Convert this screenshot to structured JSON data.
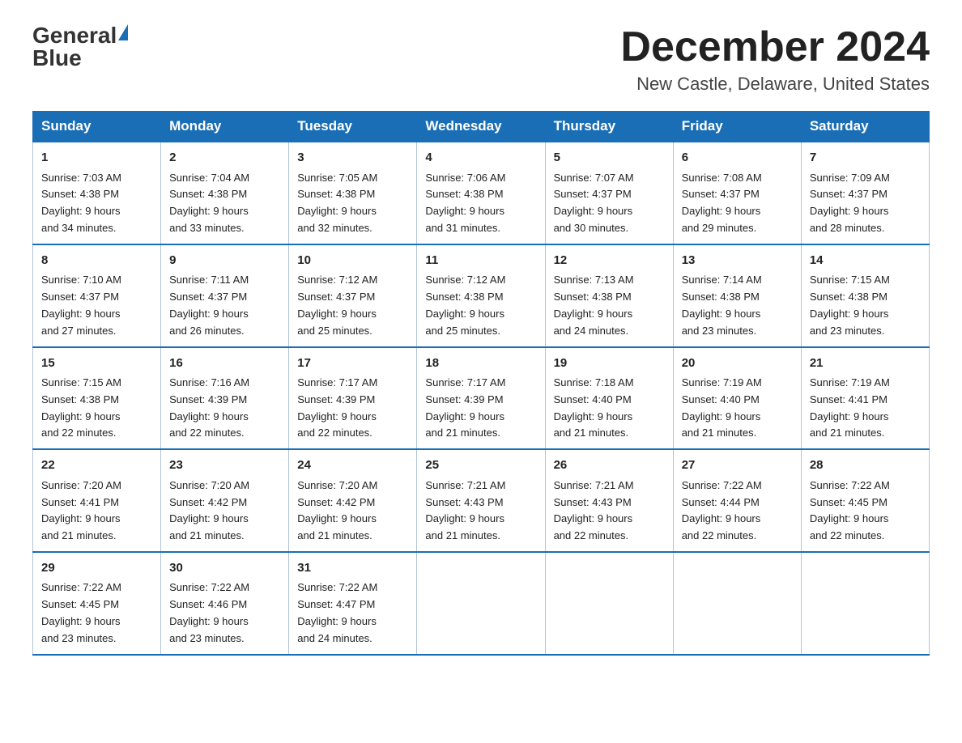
{
  "header": {
    "logo_text_general": "General",
    "logo_text_blue": "Blue",
    "month_title": "December 2024",
    "location": "New Castle, Delaware, United States"
  },
  "calendar": {
    "days_of_week": [
      "Sunday",
      "Monday",
      "Tuesday",
      "Wednesday",
      "Thursday",
      "Friday",
      "Saturday"
    ],
    "weeks": [
      [
        {
          "day": "1",
          "sunrise": "7:03 AM",
          "sunset": "4:38 PM",
          "daylight": "9 hours and 34 minutes."
        },
        {
          "day": "2",
          "sunrise": "7:04 AM",
          "sunset": "4:38 PM",
          "daylight": "9 hours and 33 minutes."
        },
        {
          "day": "3",
          "sunrise": "7:05 AM",
          "sunset": "4:38 PM",
          "daylight": "9 hours and 32 minutes."
        },
        {
          "day": "4",
          "sunrise": "7:06 AM",
          "sunset": "4:38 PM",
          "daylight": "9 hours and 31 minutes."
        },
        {
          "day": "5",
          "sunrise": "7:07 AM",
          "sunset": "4:37 PM",
          "daylight": "9 hours and 30 minutes."
        },
        {
          "day": "6",
          "sunrise": "7:08 AM",
          "sunset": "4:37 PM",
          "daylight": "9 hours and 29 minutes."
        },
        {
          "day": "7",
          "sunrise": "7:09 AM",
          "sunset": "4:37 PM",
          "daylight": "9 hours and 28 minutes."
        }
      ],
      [
        {
          "day": "8",
          "sunrise": "7:10 AM",
          "sunset": "4:37 PM",
          "daylight": "9 hours and 27 minutes."
        },
        {
          "day": "9",
          "sunrise": "7:11 AM",
          "sunset": "4:37 PM",
          "daylight": "9 hours and 26 minutes."
        },
        {
          "day": "10",
          "sunrise": "7:12 AM",
          "sunset": "4:37 PM",
          "daylight": "9 hours and 25 minutes."
        },
        {
          "day": "11",
          "sunrise": "7:12 AM",
          "sunset": "4:38 PM",
          "daylight": "9 hours and 25 minutes."
        },
        {
          "day": "12",
          "sunrise": "7:13 AM",
          "sunset": "4:38 PM",
          "daylight": "9 hours and 24 minutes."
        },
        {
          "day": "13",
          "sunrise": "7:14 AM",
          "sunset": "4:38 PM",
          "daylight": "9 hours and 23 minutes."
        },
        {
          "day": "14",
          "sunrise": "7:15 AM",
          "sunset": "4:38 PM",
          "daylight": "9 hours and 23 minutes."
        }
      ],
      [
        {
          "day": "15",
          "sunrise": "7:15 AM",
          "sunset": "4:38 PM",
          "daylight": "9 hours and 22 minutes."
        },
        {
          "day": "16",
          "sunrise": "7:16 AM",
          "sunset": "4:39 PM",
          "daylight": "9 hours and 22 minutes."
        },
        {
          "day": "17",
          "sunrise": "7:17 AM",
          "sunset": "4:39 PM",
          "daylight": "9 hours and 22 minutes."
        },
        {
          "day": "18",
          "sunrise": "7:17 AM",
          "sunset": "4:39 PM",
          "daylight": "9 hours and 21 minutes."
        },
        {
          "day": "19",
          "sunrise": "7:18 AM",
          "sunset": "4:40 PM",
          "daylight": "9 hours and 21 minutes."
        },
        {
          "day": "20",
          "sunrise": "7:19 AM",
          "sunset": "4:40 PM",
          "daylight": "9 hours and 21 minutes."
        },
        {
          "day": "21",
          "sunrise": "7:19 AM",
          "sunset": "4:41 PM",
          "daylight": "9 hours and 21 minutes."
        }
      ],
      [
        {
          "day": "22",
          "sunrise": "7:20 AM",
          "sunset": "4:41 PM",
          "daylight": "9 hours and 21 minutes."
        },
        {
          "day": "23",
          "sunrise": "7:20 AM",
          "sunset": "4:42 PM",
          "daylight": "9 hours and 21 minutes."
        },
        {
          "day": "24",
          "sunrise": "7:20 AM",
          "sunset": "4:42 PM",
          "daylight": "9 hours and 21 minutes."
        },
        {
          "day": "25",
          "sunrise": "7:21 AM",
          "sunset": "4:43 PM",
          "daylight": "9 hours and 21 minutes."
        },
        {
          "day": "26",
          "sunrise": "7:21 AM",
          "sunset": "4:43 PM",
          "daylight": "9 hours and 22 minutes."
        },
        {
          "day": "27",
          "sunrise": "7:22 AM",
          "sunset": "4:44 PM",
          "daylight": "9 hours and 22 minutes."
        },
        {
          "day": "28",
          "sunrise": "7:22 AM",
          "sunset": "4:45 PM",
          "daylight": "9 hours and 22 minutes."
        }
      ],
      [
        {
          "day": "29",
          "sunrise": "7:22 AM",
          "sunset": "4:45 PM",
          "daylight": "9 hours and 23 minutes."
        },
        {
          "day": "30",
          "sunrise": "7:22 AM",
          "sunset": "4:46 PM",
          "daylight": "9 hours and 23 minutes."
        },
        {
          "day": "31",
          "sunrise": "7:22 AM",
          "sunset": "4:47 PM",
          "daylight": "9 hours and 24 minutes."
        },
        null,
        null,
        null,
        null
      ]
    ]
  }
}
